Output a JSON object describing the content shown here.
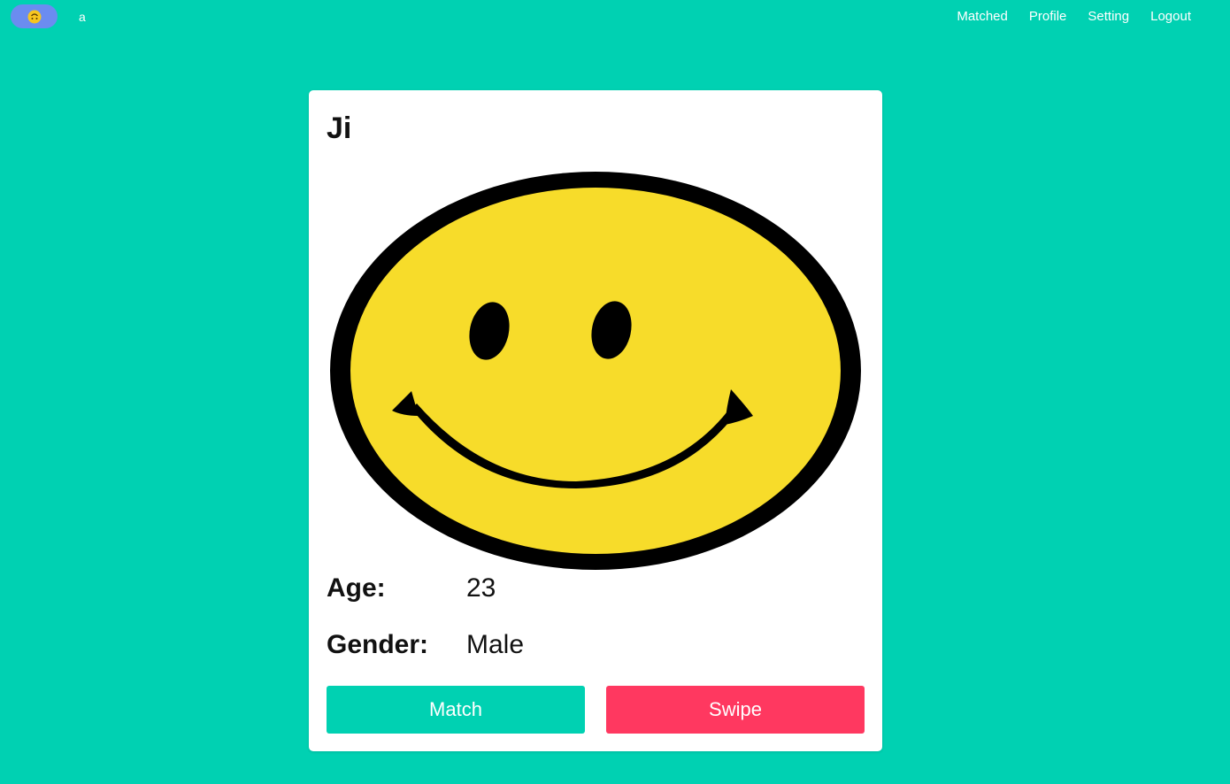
{
  "navbar": {
    "brand_icon": "upside-down-face-emoji",
    "user_name": "a",
    "links": [
      "Matched",
      "Profile",
      "Setting",
      "Logout"
    ]
  },
  "card": {
    "name": "Ji",
    "image": "smiley-face",
    "age_label": "Age:",
    "age_value": "23",
    "gender_label": "Gender:",
    "gender_value": "Male",
    "match_label": "Match",
    "swipe_label": "Swipe"
  },
  "colors": {
    "background": "#00d1b2",
    "match": "#00d1b2",
    "swipe": "#ff3860",
    "brand_pill": "#6b8cf0",
    "smiley_yellow": "#f7dc2a"
  }
}
